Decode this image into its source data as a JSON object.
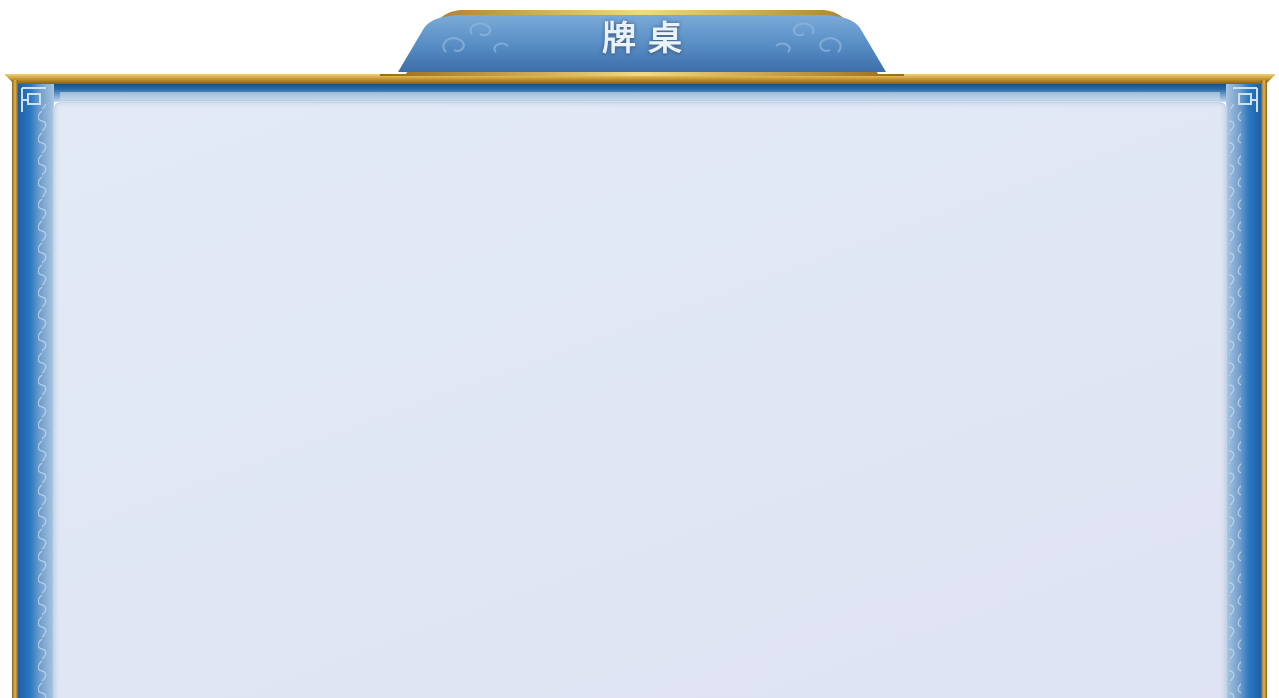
{
  "window": {
    "title": "牌桌"
  },
  "colors": {
    "gold": "#c9952c",
    "gold_light": "#e8c566",
    "frame_blue": "#2a6fb4",
    "frame_light": "#8fb3d6",
    "plaque_blue": "#5a8fc6",
    "board_fill": "#e1e7f5"
  },
  "icons": {
    "plaque_clouds": "cloud-swirl-ornament-icon",
    "corner_ornaments": "fret-corner-ornament-icon",
    "border_pattern": "cloud-scroll-border-icon"
  }
}
